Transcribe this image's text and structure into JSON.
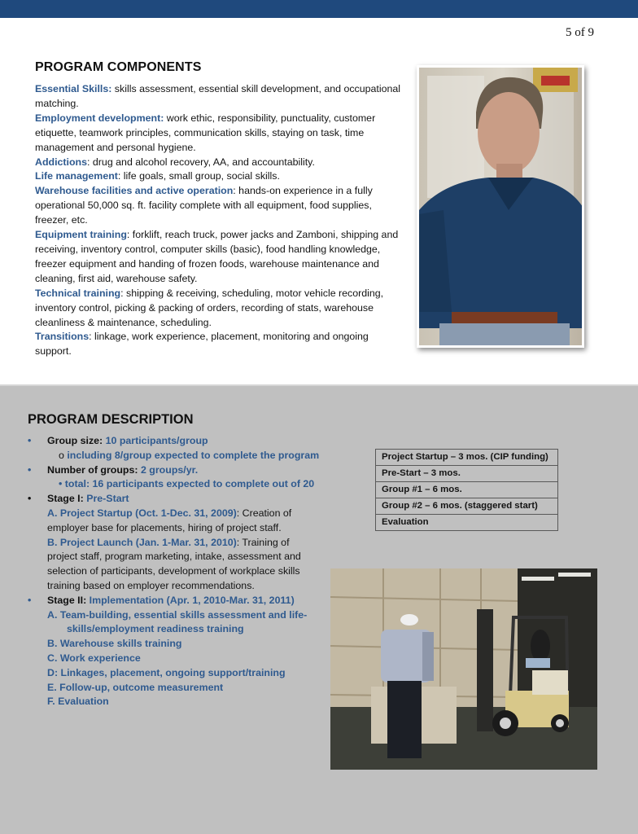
{
  "header": {
    "page_number": "5 of 9",
    "bar_color": "#1f497d"
  },
  "components": {
    "title": "PROGRAM COMPONENTS",
    "items": [
      {
        "term": "Essential Skills:",
        "text": " skills assessment, essential skill development, and occupational matching."
      },
      {
        "term": "Employment development:",
        "text": " work ethic, responsibility, punctuality, customer etiquette, teamwork principles, communication skills, staying on task, time management and personal hygiene."
      },
      {
        "term": "Addictions",
        "text": ": drug and alcohol recovery, AA, and accountability."
      },
      {
        "term": "Life management",
        "text": ": life goals, small group, social skills."
      },
      {
        "term": "Warehouse facilities and active operation",
        "text": ": hands-on experience in a fully operational 50,000 sq. ft. facility complete with all equipment, food supplies, freezer, etc."
      },
      {
        "term": "Equipment training",
        "text": ": forklift, reach truck, power jacks and Zamboni, shipping and receiving, inventory control, computer skills (basic), food handling knowledge, freezer equipment and handing of frozen foods, warehouse maintenance and cleaning, first aid, warehouse safety."
      },
      {
        "term": "Technical training",
        "text": ": shipping & receiving, scheduling, motor vehicle recording, inventory control, picking & packing of orders, recording of stats, warehouse cleanliness  & maintenance, scheduling."
      },
      {
        "term": "Transitions",
        "text": ": linkage, work experience, placement, monitoring and ongoing support."
      }
    ],
    "photo": "man-in-blue-shirt-photo"
  },
  "description": {
    "title": "PROGRAM DESCRIPTION",
    "group_size": {
      "label": "Group size:",
      "value": " 10 participants/group",
      "sub_bullet": "o",
      "sub": "including 8/group expected to complete the program"
    },
    "groups": {
      "label": "Number of groups:",
      "value": " 2 groups/yr.",
      "sub_bullet": "•",
      "sub": "total: 16 participants expected to complete   out of 20"
    },
    "stage1": {
      "label": "Stage I:",
      "value": " Pre-Start",
      "a_term": "A. Project Startup (Oct. 1-Dec. 31, 2009)",
      "a_text": ": Creation of employer base for placements, hiring of project staff.",
      "b_term": "B. Project Launch (Jan. 1-Mar. 31, 2010)",
      "b_text": ": Training of project staff, program marketing, intake, assessment and selection of participants, development of workplace skills training based on employer recommendations."
    },
    "stage2": {
      "label": "Stage II:",
      "value": " Implementation (Apr. 1, 2010-Mar. 31, 2011)",
      "steps": [
        "A.   Team-building, essential skills assessment and life-skills/employment readiness training",
        "B. Warehouse skills training",
        "C. Work experience",
        "D: Linkages, placement, ongoing support/training",
        "E. Follow-up, outcome measurement",
        "F. Evaluation"
      ]
    },
    "bullet_glyph": "•"
  },
  "timeline": {
    "rows": [
      "Project Startup – 3 mos. (CIP funding)",
      "Pre-Start – 3 mos.",
      "Group #1 – 6 mos.",
      "Group #2 – 6 mos. (staggered start)",
      "Evaluation"
    ]
  },
  "photos": {
    "forklift": "warehouse-forklift-photo"
  },
  "colors": {
    "accent_blue": "#2f5a8f",
    "lower_background": "#c0c0c0"
  }
}
